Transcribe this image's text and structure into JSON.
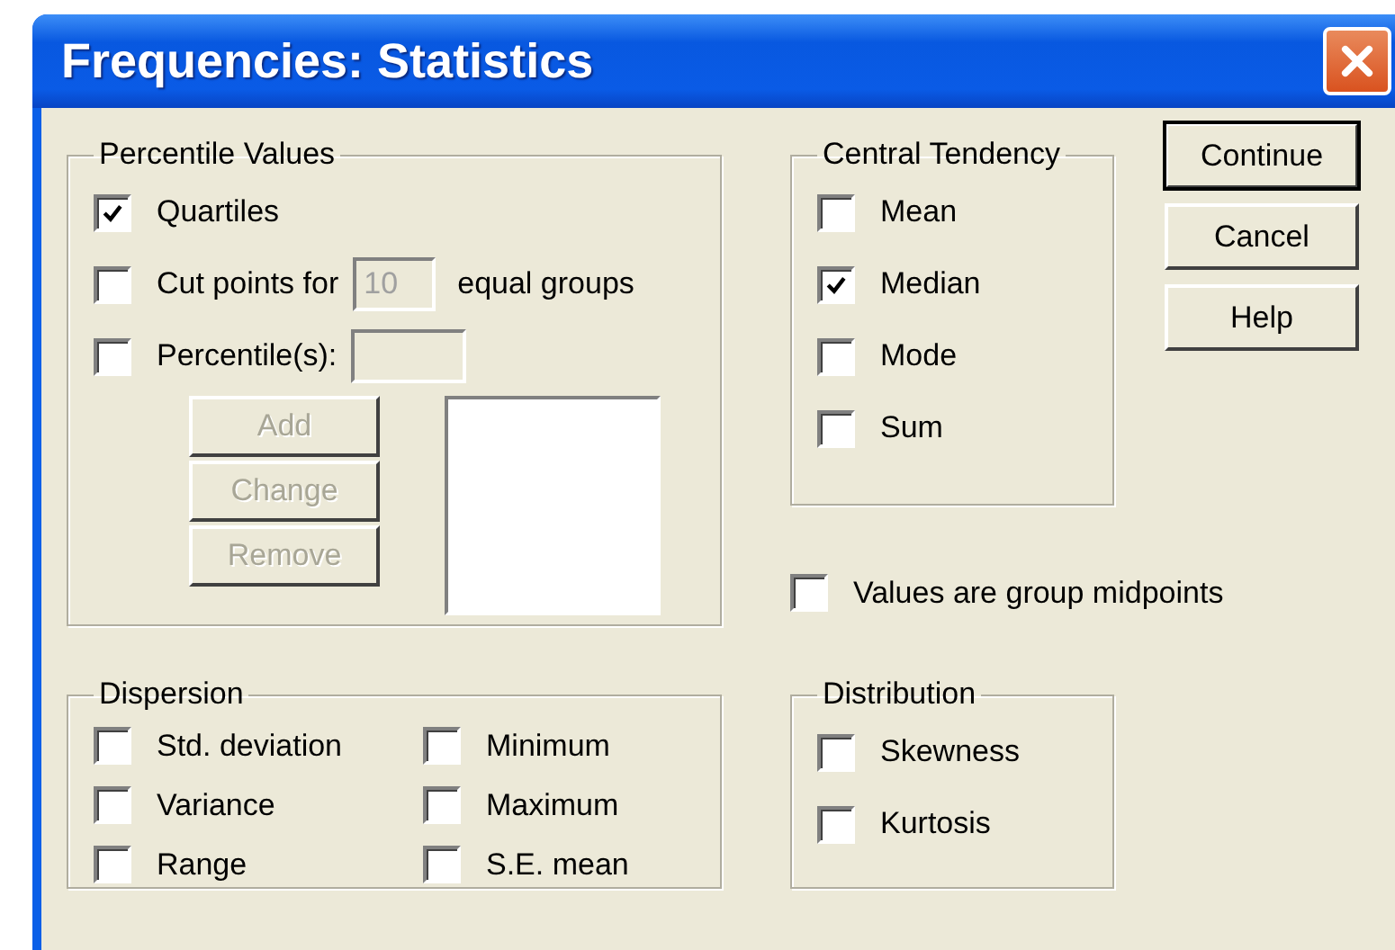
{
  "window": {
    "title": "Frequencies: Statistics"
  },
  "percentile_values": {
    "title": "Percentile Values",
    "quartiles": {
      "label": "Quartiles",
      "checked": true
    },
    "cut_points": {
      "label": "Cut points for",
      "checked": false,
      "value": "10",
      "suffix": "equal groups"
    },
    "percentiles": {
      "label": "Percentile(s):",
      "checked": false
    },
    "buttons": [
      {
        "label": "Add",
        "disabled": true
      },
      {
        "label": "Change",
        "disabled": true
      },
      {
        "label": "Remove",
        "disabled": true
      }
    ]
  },
  "central_tendency": {
    "title": "Central Tendency",
    "items": [
      {
        "label": "Mean",
        "checked": false
      },
      {
        "label": "Median",
        "checked": true
      },
      {
        "label": "Mode",
        "checked": false
      },
      {
        "label": "Sum",
        "checked": false
      }
    ]
  },
  "group_midpoints": {
    "label": "Values are group midpoints",
    "checked": false
  },
  "dispersion": {
    "title": "Dispersion",
    "items": [
      {
        "label": "Std. deviation",
        "checked": false
      },
      {
        "label": "Minimum",
        "checked": false
      },
      {
        "label": "Variance",
        "checked": false
      },
      {
        "label": "Maximum",
        "checked": false
      },
      {
        "label": "Range",
        "checked": false
      },
      {
        "label": "S.E. mean",
        "checked": false
      }
    ]
  },
  "distribution": {
    "title": "Distribution",
    "items": [
      {
        "label": "Skewness",
        "checked": false
      },
      {
        "label": "Kurtosis",
        "checked": false
      }
    ]
  },
  "buttons": [
    {
      "label": "Continue",
      "default": true
    },
    {
      "label": "Cancel",
      "default": false
    },
    {
      "label": "Help",
      "default": false
    }
  ]
}
